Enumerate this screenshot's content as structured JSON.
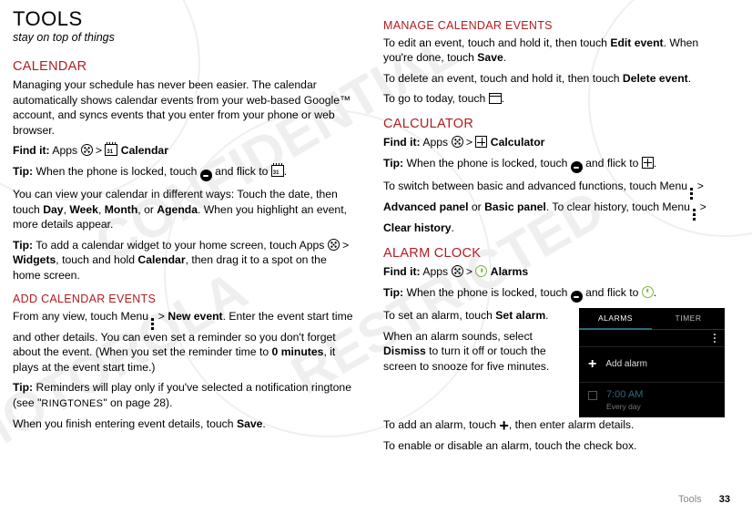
{
  "title": "Tools",
  "tagline": "stay on top of things",
  "left": {
    "calendar_head": "Calendar",
    "calendar_p1": "Managing your schedule has never been easier. The calendar automatically shows calendar events from your web-based Google™ account, and syncs events that you enter from your phone or web browser.",
    "findit": "Find it:",
    "apps": "Apps",
    "cal_label": "Calendar",
    "tip": "Tip:",
    "tip_lock_a": "When the phone is locked, touch ",
    "tip_lock_b": " and flick to ",
    "views_a": "You can view your calendar in different ways: Touch the date, then touch ",
    "day": "Day",
    "week": "Week",
    "month": "Month",
    "agenda": "Agenda",
    "views_b": ". When you highlight an event, more details appear.",
    "tip_widget_a": "To add a calendar widget to your home screen, touch Apps ",
    "widgets": "Widgets",
    "tip_widget_b": ", touch and hold ",
    "calendar_bold": "Calendar",
    "tip_widget_c": ", then drag it to a spot on the home screen.",
    "add_head": "Add calendar events",
    "add_p_a": "From any view, touch Menu ",
    "new_event": "New event",
    "add_p_b": ". Enter the event start time and other details. You can even set a reminder so you don't forget about the event. (When you set the reminder time to ",
    "zero_min": "0 minutes",
    "add_p_c": ", it plays at the event start time.)",
    "tip_ring_a": "Reminders will play only if you've selected a notification ringtone (see \"",
    "ringtones": "Ringtones",
    "tip_ring_b": "\" on page 28).",
    "save_p": "When you finish entering event details, touch ",
    "save": "Save"
  },
  "right": {
    "manage_head": "Manage calendar events",
    "manage_p1_a": "To edit an event, touch and hold it, then touch ",
    "edit_event": "Edit event",
    "manage_p1_b": ". When you're done, touch ",
    "save": "Save",
    "manage_p2_a": "To delete an event, touch and hold it, then touch ",
    "delete_event": "Delete event",
    "today_a": "To go to today, touch ",
    "calc_head": "Calculator",
    "findit": "Find it:",
    "apps": "Apps",
    "calc_label": "Calculator",
    "tip": "Tip:",
    "tip_lock_a": "When the phone is locked, touch ",
    "tip_lock_b": " and flick to ",
    "switch_a": "To switch between basic and advanced functions, touch Menu ",
    "adv_panel": "Advanced panel",
    "or": " or ",
    "basic_panel": "Basic panel",
    "switch_b": ". To clear history, touch Menu ",
    "clear_hist": "Clear history",
    "alarm_head": "Alarm clock",
    "alarms_label": "Alarms",
    "set_a": "To set an alarm, touch ",
    "set_alarm": "Set alarm",
    "sounds_a": "When an alarm sounds, select ",
    "dismiss": "Dismiss",
    "sounds_b": " to turn it off or touch the screen to snooze for five minutes.",
    "add_a": "To add an alarm, touch ",
    "add_b": ", then enter alarm details.",
    "enable_p": "To enable or disable an alarm, touch the check box."
  },
  "phone": {
    "tab_alarms": "ALARMS",
    "tab_timer": "TIMER",
    "add_alarm": "Add alarm",
    "time": "7:00 AM",
    "repeat": "Every day"
  },
  "footer_label": "Tools",
  "page_num": "33"
}
